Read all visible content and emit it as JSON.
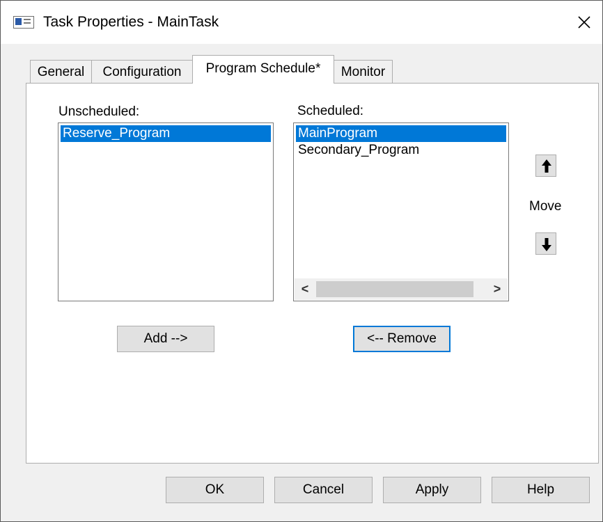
{
  "window": {
    "title": "Task Properties - MainTask",
    "close_glyph": "✕"
  },
  "tabs": [
    {
      "label": "General",
      "active": false
    },
    {
      "label": "Configuration",
      "active": false
    },
    {
      "label": "Program Schedule*",
      "active": true
    },
    {
      "label": "Monitor",
      "active": false
    }
  ],
  "unscheduled": {
    "label": "Unscheduled:",
    "items": [
      {
        "label": "Reserve_Program",
        "selected": true
      }
    ]
  },
  "scheduled": {
    "label": "Scheduled:",
    "items": [
      {
        "label": "MainProgram",
        "selected": true
      },
      {
        "label": "Secondary_Program",
        "selected": false
      }
    ],
    "scroll_left_glyph": "<",
    "scroll_right_glyph": ">"
  },
  "buttons": {
    "add": "Add -->",
    "remove": "<-- Remove",
    "move_label": "Move",
    "ok": "OK",
    "cancel": "Cancel",
    "apply": "Apply",
    "help": "Help"
  },
  "icons": {
    "window": "task-window-icon",
    "close": "close-icon",
    "move_up": "arrow-up-icon",
    "move_down": "arrow-down-icon"
  },
  "colors": {
    "selection": "#0078d7",
    "focus_border": "#0078d7",
    "dialog_bg": "#f0f0f0",
    "button_bg": "#e1e1e1"
  }
}
